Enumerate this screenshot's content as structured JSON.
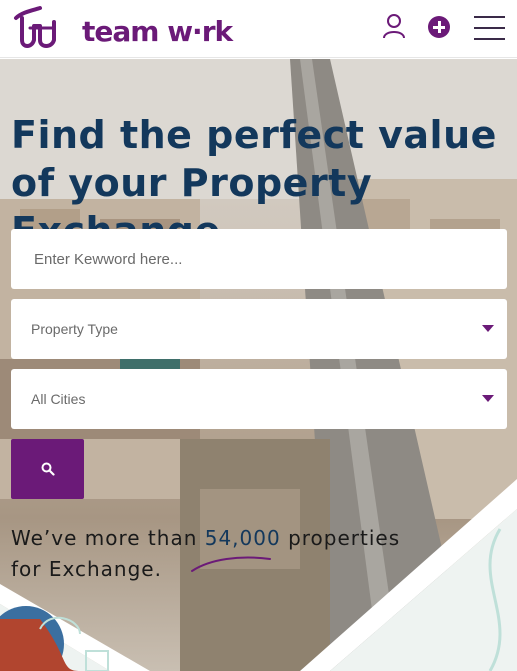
{
  "header": {
    "logo_text": "team w·rk",
    "icons": {
      "user": "user-icon",
      "add": "plus-circle-icon",
      "menu": "hamburger-menu-icon"
    },
    "accent_color": "#6b1a78"
  },
  "hero": {
    "title": "Find the perfect value of your Property Exchange",
    "keyword": {
      "placeholder": "Enter Kewword here...",
      "value": ""
    },
    "property_type": {
      "selected": "Property Type"
    },
    "city": {
      "selected": "All Cities"
    },
    "search_button": {
      "icon": "search-icon"
    },
    "tagline": {
      "prefix": "We’ve more than ",
      "number": "54,000",
      "suffix": " properties for Exchange."
    },
    "title_color": "#13385c"
  }
}
